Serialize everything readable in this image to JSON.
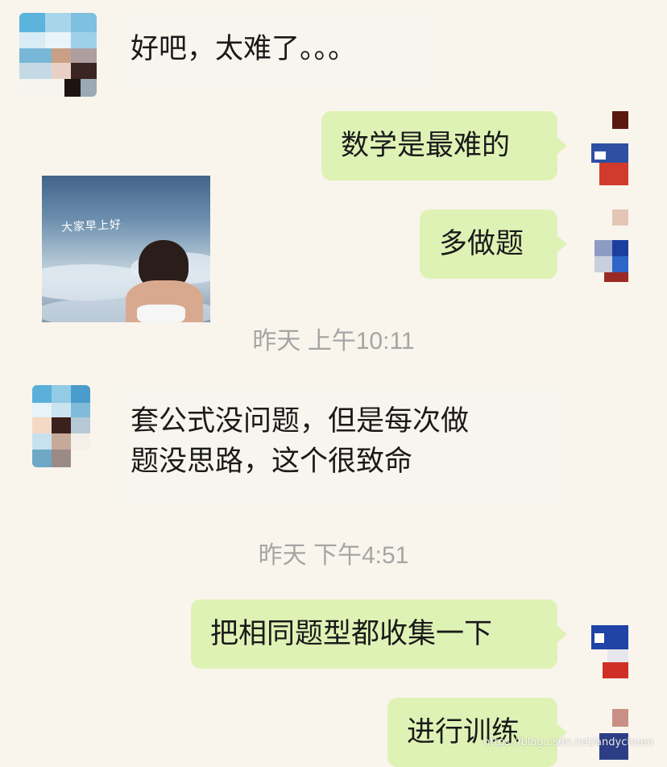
{
  "messages": {
    "m1": "好吧，太难了。。。",
    "m2": "数学是最难的",
    "m4": "多做题",
    "m5_line1": "套公式没问题，但是每次做",
    "m5_line2": "题没思路，这个很致命",
    "m6": "把相同题型都收集一下",
    "m7": "进行训练"
  },
  "timestamps": {
    "t1": "昨天 上午10:11",
    "t2": "昨天 下午4:51"
  },
  "sticker": {
    "caption": "大家早上好"
  },
  "watermark": "https://blog.csdn.net/andychuen",
  "colors": {
    "background": "#f9f5ec",
    "right_bubble": "#dff2b5",
    "left_bubble": "#f8f5ee",
    "timestamp": "#a5a5a5"
  }
}
